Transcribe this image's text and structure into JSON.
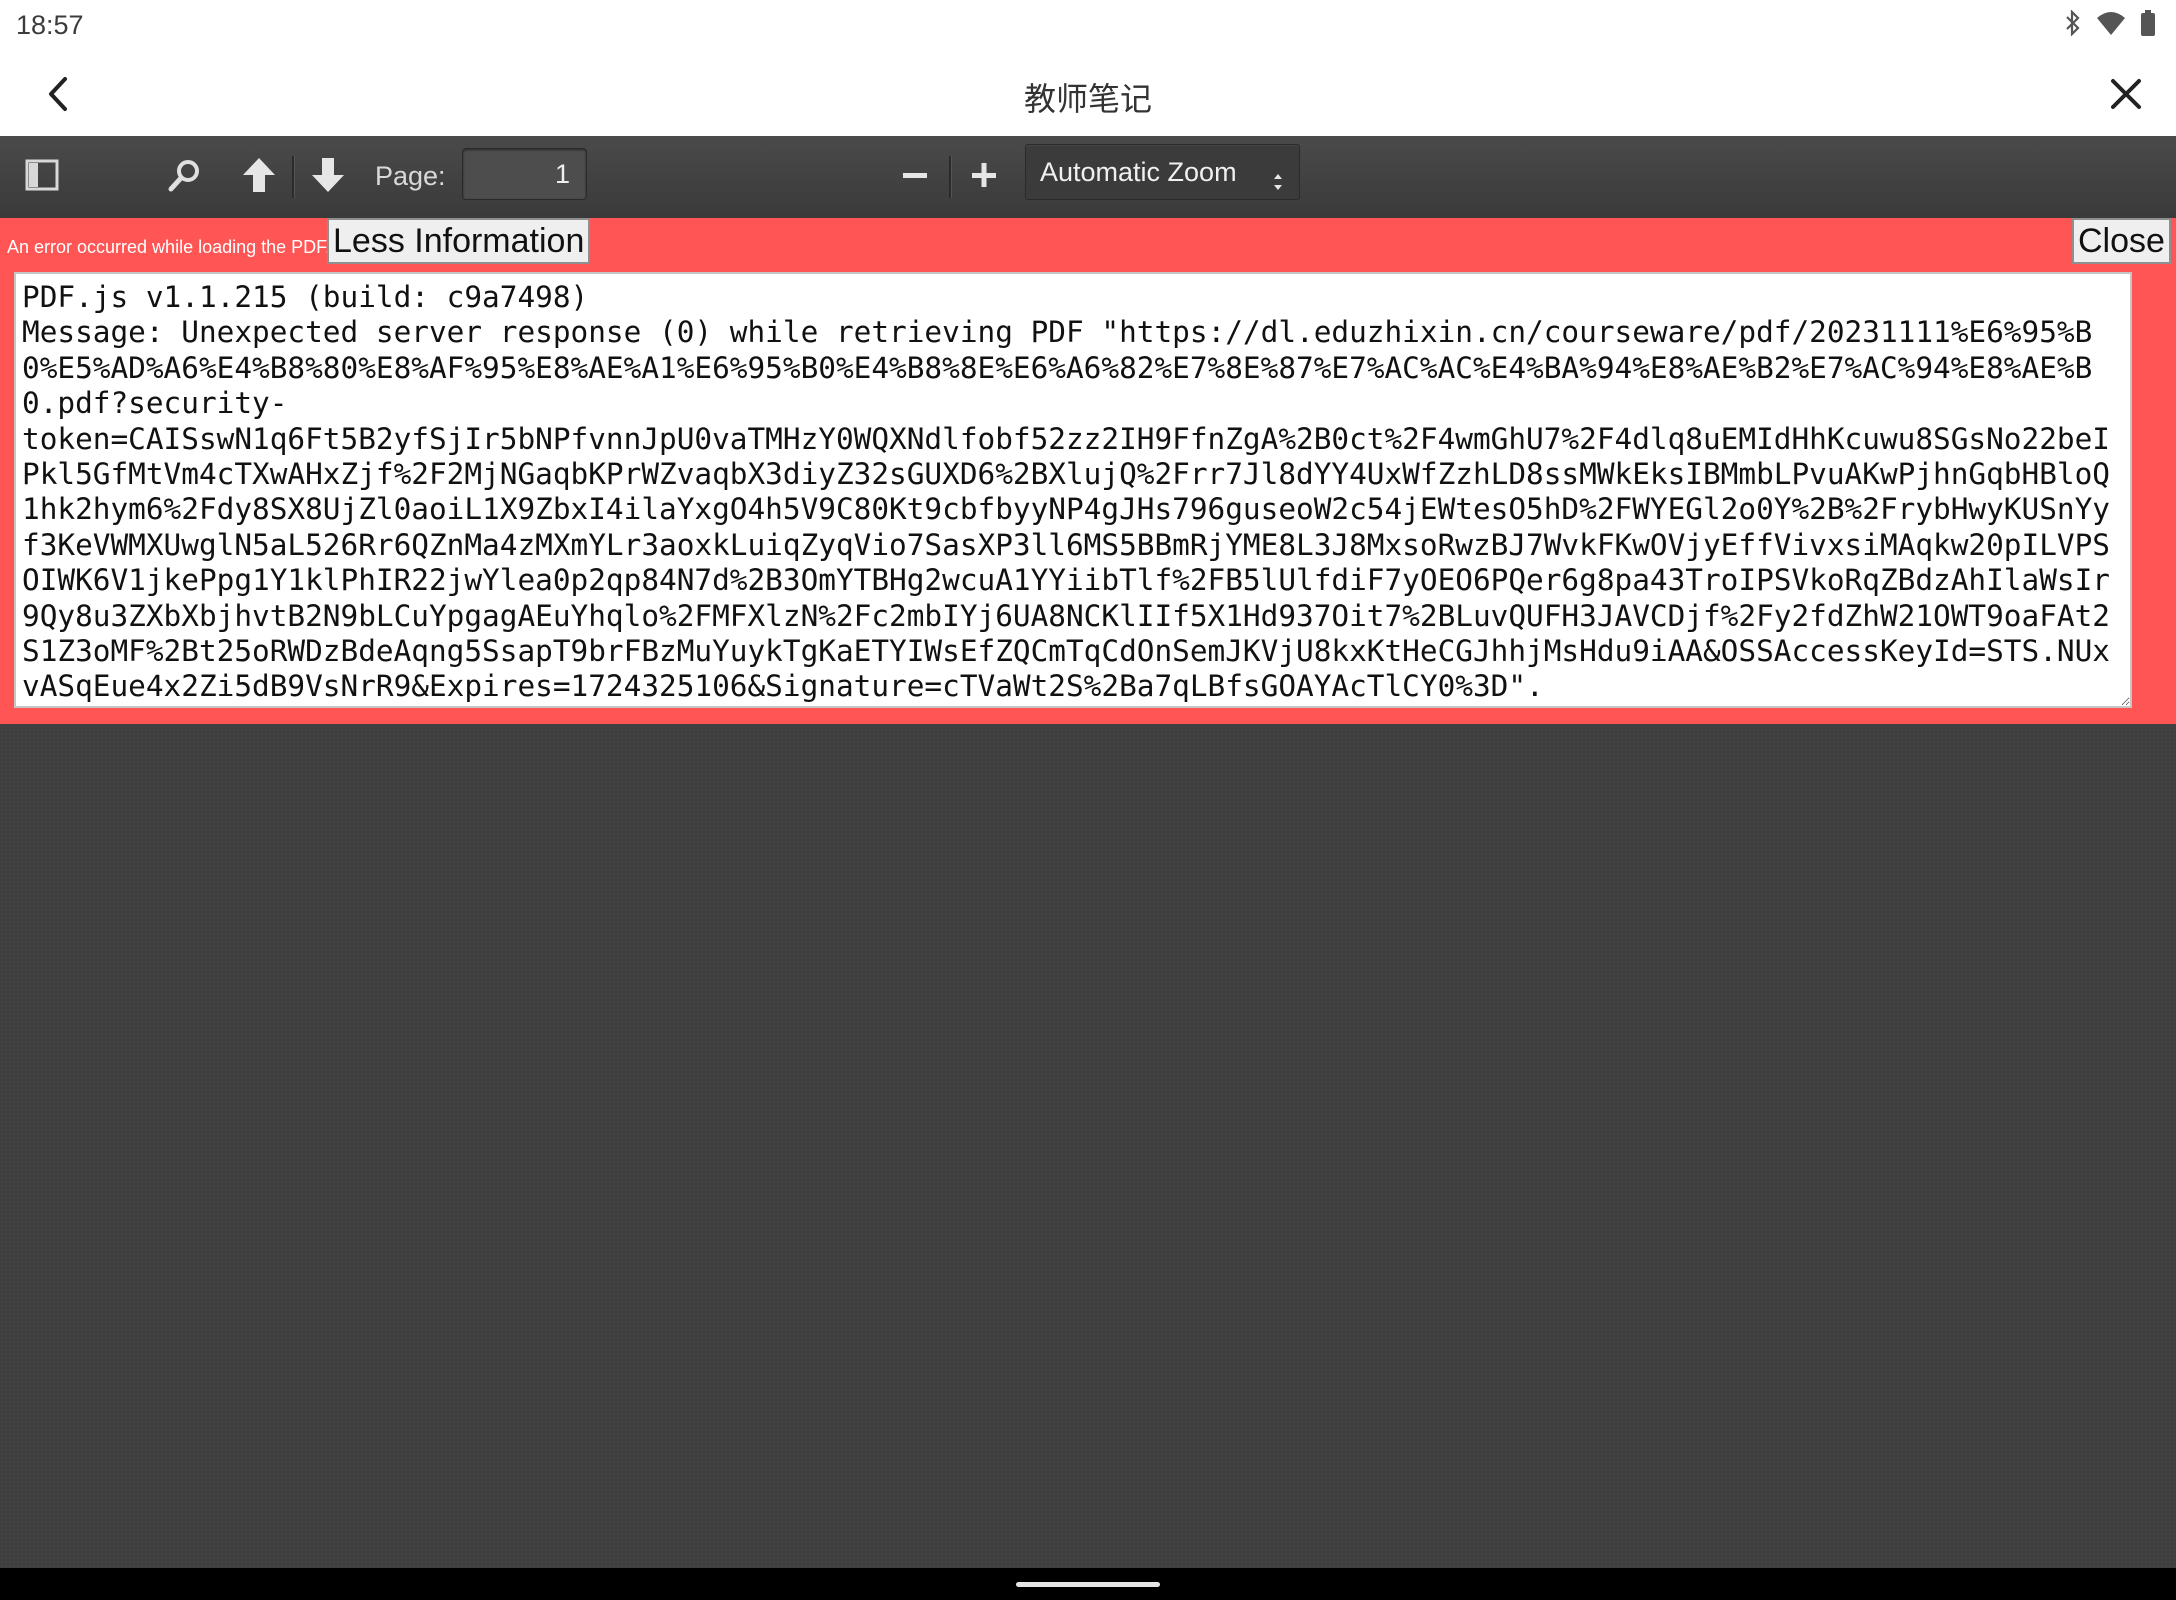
{
  "status_bar": {
    "time": "18:57",
    "icons": [
      "bluetooth-icon",
      "wifi-icon",
      "battery-icon"
    ]
  },
  "app_bar": {
    "title": "教师笔记",
    "back_icon": "chevron-left-icon",
    "close_icon": "close-icon"
  },
  "toolbar": {
    "sidebar_toggle_icon": "sidebar-toggle-icon",
    "search_icon": "search-icon",
    "previous_icon": "arrow-up-icon",
    "next_icon": "arrow-down-icon",
    "page_label": "Page:",
    "page_value": "1",
    "zoom_out_icon": "minus-icon",
    "zoom_in_icon": "plus-icon",
    "zoom_selected": "Automatic Zoom"
  },
  "error": {
    "message": "An error occurred while loading the PDF.",
    "less_info_label": "Less Information",
    "close_label": "Close",
    "details": "PDF.js v1.1.215 (build: c9a7498)\nMessage: Unexpected server response (0) while retrieving PDF \"https://dl.eduzhixin.cn/courseware/pdf/20231111%E6%95%B0%E5%AD%A6%E4%B8%80%E8%AF%95%E8%AE%A1%E6%95%B0%E4%B8%8E%E6%A6%82%E7%8E%87%E7%AC%AC%E4%BA%94%E8%AE%B2%E7%AC%94%E8%AE%B0.pdf?security-\ntoken=CAISswN1q6Ft5B2yfSjIr5bNPfvnnJpU0vaTMHzY0WQXNdlfobf52zz2IH9FfnZgA%2B0ct%2F4wmGhU7%2F4dlq8uEMIdHhKcuwu8SGsNo22beIPkl5GfMtVm4cTXwAHxZjf%2F2MjNGaqbKPrWZvaqbX3diyZ32sGUXD6%2BXlujQ%2Frr7Jl8dYY4UxWfZzhLD8ssMWkEksIBMmbLPvuAKwPjhnGqbHBloQ1hk2hym6%2Fdy8SX8UjZl0aoiL1X9ZbxI4ilaYxgO4h5V9C80Kt9cbfbyyNP4gJHs796guseoW2c54jEWtesO5hD%2FWYEGl2o0Y%2B%2FrybHwyKUSnYyf3KeVWMXUwglN5aL526Rr6QZnMa4zMXmYLr3aoxkLuiqZyqVio7SasXP3ll6MS5BBmRjYME8L3J8MxsoRwzBJ7WvkFKwOVjyEffVivxsiMAqkw20pILVPSOIWK6V1jkePpg1Y1klPhIR22jwYlea0p2qp84N7d%2B3OmYTBHg2wcuA1YYiibTlf%2FB5lUlfdiF7yOEO6PQer6g8pa43TroIPSVkoRqZBdzAhIlaWsIr9Qy8u3ZXbXbjhvtB2N9bLCuYpgagAEuYhqlo%2FMFXlzN%2Fc2mbIYj6UA8NCKlIIf5X1Hd937Oit7%2BLuvQUFH3JAVCDjf%2Fy2fdZhW21OWT9oaFAt2S1Z3oMF%2Bt25oRWDzBdeAqng5SsapT9brFBzMuYuykTgKaETYIWsEfZQCmTqCdOnSemJKVjU8kxKtHeCGJhhjMsHdu9iAA&OSSAccessKeyId=STS.NUxvASqEue4x2Zi5dB9VsNrR9&Expires=1724325106&Signature=cTVaWt2S%2Ba7qLBfsGOAYAcTlCY0%3D\"."
  },
  "colors": {
    "error_bg": "#ff5555",
    "toolbar_bg": "#474747",
    "viewer_bg": "#404040"
  }
}
